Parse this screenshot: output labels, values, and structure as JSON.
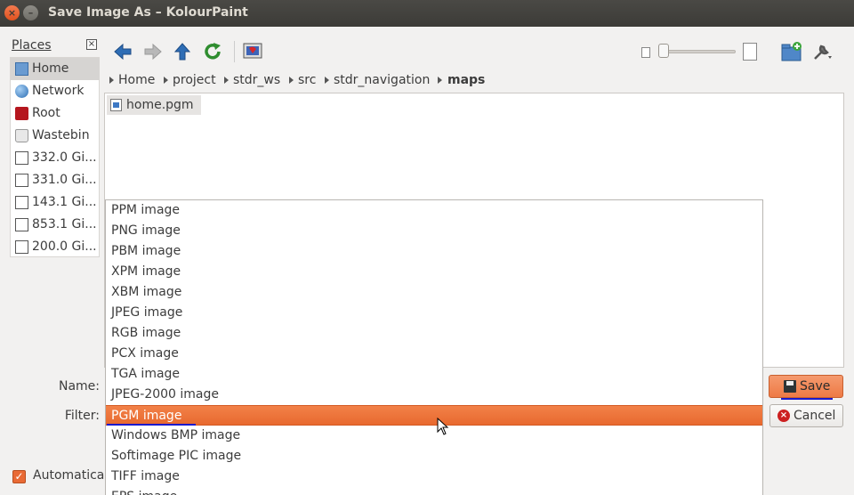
{
  "window": {
    "title": "Save Image As – KolourPaint",
    "close_glyph": "×",
    "minimize_glyph": "–"
  },
  "places": {
    "header": "Places",
    "close_glyph": "×",
    "items": [
      {
        "label": "Home",
        "icon": "home-folder-icon"
      },
      {
        "label": "Network",
        "icon": "network-globe-icon"
      },
      {
        "label": "Root",
        "icon": "root-folder-icon"
      },
      {
        "label": "Wastebin",
        "icon": "trash-icon"
      },
      {
        "label": "332.0 Gi...",
        "icon": "drive-icon"
      },
      {
        "label": "331.0 Gi...",
        "icon": "drive-icon"
      },
      {
        "label": "143.1 Gi...",
        "icon": "drive-icon"
      },
      {
        "label": "853.1 Gi...",
        "icon": "drive-icon"
      },
      {
        "label": "200.0 Gi...",
        "icon": "drive-icon"
      }
    ],
    "selected_index": 0
  },
  "toolbar": {
    "icons": [
      "back-arrow-icon",
      "forward-arrow-icon",
      "up-arrow-icon",
      "reload-icon",
      "preview-icon",
      "new-folder-icon",
      "options-wrench-icon"
    ],
    "zoom_slider_level": 0
  },
  "breadcrumb": {
    "segments": [
      "Home",
      "project",
      "stdr_ws",
      "src",
      "stdr_navigation",
      "maps"
    ]
  },
  "files": [
    {
      "name": "home.pgm",
      "icon": "image-file-icon"
    }
  ],
  "form": {
    "name_label": "Name:",
    "filter_label": "Filter:",
    "checkbox_label": "Automatical",
    "checkbox_checked": true
  },
  "buttons": {
    "save": "Save",
    "cancel": "Cancel"
  },
  "filter_dropdown": {
    "options": [
      "PPM image",
      "PNG image",
      "PBM image",
      "XPM image",
      "XBM image",
      "JPEG image",
      "RGB image",
      "PCX image",
      "TGA image",
      "JPEG-2000 image",
      "PGM image",
      "Windows BMP image",
      "Softimage PIC image",
      "TIFF image",
      "EPS image"
    ],
    "selected": "PGM image"
  },
  "colors": {
    "accent": "#ee7a45",
    "titlebar": "#3c3b37",
    "underline": "#1a1acc"
  }
}
